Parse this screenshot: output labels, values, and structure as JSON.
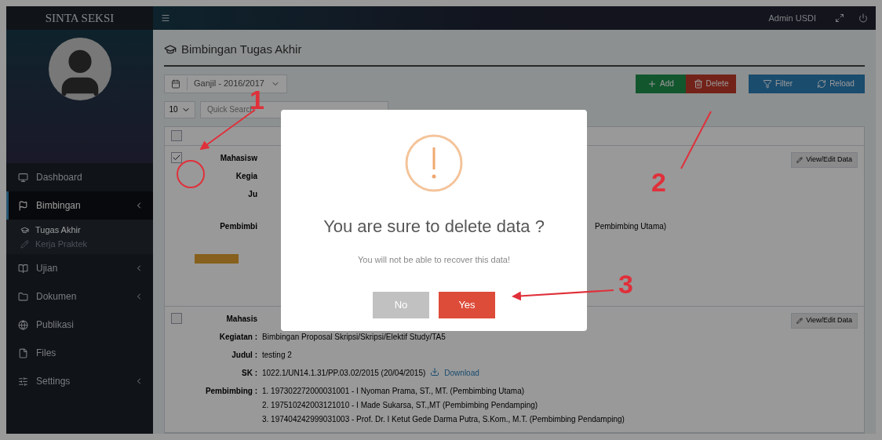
{
  "sidebar": {
    "brand": "SINTA SEKSI",
    "items": [
      {
        "label": "Dashboard",
        "expandable": false,
        "selected": false
      },
      {
        "label": "Bimbingan",
        "expandable": true,
        "selected": true,
        "children": [
          {
            "label": "Tugas Akhir",
            "selected": true
          },
          {
            "label": "Kerja Praktek",
            "selected": false
          }
        ]
      },
      {
        "label": "Ujian",
        "expandable": true,
        "selected": false
      },
      {
        "label": "Dokumen",
        "expandable": true,
        "selected": false
      },
      {
        "label": "Publikasi",
        "expandable": false,
        "selected": false
      },
      {
        "label": "Files",
        "expandable": false,
        "selected": false
      },
      {
        "label": "Settings",
        "expandable": true,
        "selected": false
      }
    ]
  },
  "topbar": {
    "user": "Admin USDI"
  },
  "page": {
    "select_all_checked": false,
    "title": "Bimbingan Tugas Akhir",
    "semester": "Ganjil - 2016/2017",
    "page_size": "10",
    "search_placeholder": "Quick Search",
    "buttons": [
      {
        "label": "Add",
        "kind": "add"
      },
      {
        "label": "Delete",
        "kind": "delete"
      },
      {
        "label": "Filter",
        "kind": "filter"
      },
      {
        "label": "Reload",
        "kind": "reload"
      }
    ]
  },
  "rows": [
    {
      "checked": true,
      "labels": [
        {
          "text": "Mahasisw",
          "kind": "student"
        },
        {
          "text": "Kegia",
          "kind": "activity"
        },
        {
          "text": "Ju",
          "kind": "title"
        },
        {
          "text": "Pembimbi",
          "kind": "supervisor"
        }
      ],
      "values": [],
      "pembimbing_tail": "Pembimbing Utama)",
      "edit": "View/Edit Data",
      "badge": true
    },
    {
      "checked": false,
      "labels": [
        {
          "text": "Mahasis",
          "kind": "student"
        },
        {
          "text": "Kegiatan :",
          "kind": "activity"
        },
        {
          "text": "Judul :",
          "kind": "title"
        },
        {
          "text": "SK :",
          "kind": "decree"
        },
        {
          "text": "Pembimbing :",
          "kind": "supervisor"
        }
      ],
      "values": [
        "Bimbingan Proposal Skripsi/Skripsi/Elektif Study/TA5",
        "testing 2",
        "1022.1/UN14.1.31/PP.03.02/2015 (20/04/2015)"
      ],
      "download": "Download",
      "pembimbing": [
        "1. 197302272000031001 - I Nyoman Prama, ST., MT. (Pembimbing Utama)",
        "2. 197510242003121010 - I Made Sukarsa, ST.,MT (Pembimbing Pendamping)",
        "3. 197404242999031003 - Prof. Dr. I Ketut Gede Darma Putra, S.Kom., M.T. (Pembimbing Pendamping)"
      ],
      "edit": "View/Edit Data",
      "badge": false
    }
  ],
  "dialog": {
    "title": "You are sure to delete data ?",
    "text": "You will not be able to recover this data!",
    "buttons": [
      {
        "label": "No",
        "kind": "cancel"
      },
      {
        "label": "Yes",
        "kind": "confirm"
      }
    ]
  },
  "annotations": [
    {
      "label": "1"
    },
    {
      "label": "2"
    },
    {
      "label": "3"
    }
  ]
}
